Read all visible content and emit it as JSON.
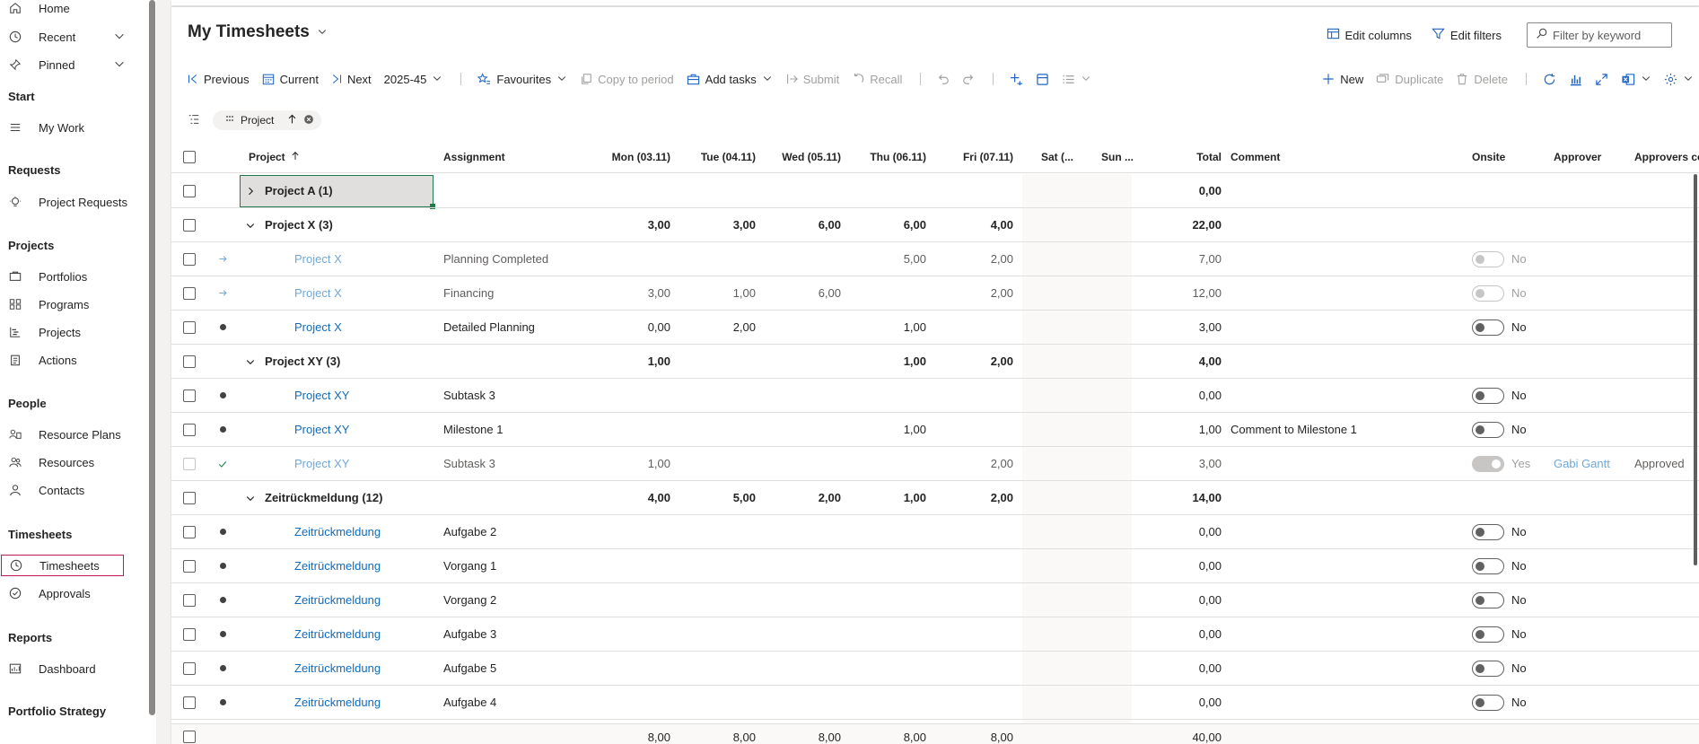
{
  "sidebar": {
    "home": "Home",
    "recent": "Recent",
    "pinned": "Pinned",
    "sections": {
      "start": "Start",
      "requests": "Requests",
      "projects": "Projects",
      "people": "People",
      "timesheets": "Timesheets",
      "reports": "Reports",
      "portfolio_strategy": "Portfolio Strategy"
    },
    "items": {
      "my_work": "My Work",
      "project_requests": "Project Requests",
      "portfolios": "Portfolios",
      "programs": "Programs",
      "projects": "Projects",
      "actions": "Actions",
      "resource_plans": "Resource Plans",
      "resources": "Resources",
      "contacts": "Contacts",
      "timesheets": "Timesheets",
      "approvals": "Approvals",
      "dashboard": "Dashboard"
    }
  },
  "header": {
    "title": "My Timesheets",
    "edit_columns": "Edit columns",
    "edit_filters": "Edit filters",
    "filter_placeholder": "Filter by keyword"
  },
  "toolbar": {
    "previous": "Previous",
    "current": "Current",
    "next": "Next",
    "period": "2025-45",
    "favourites": "Favourites",
    "copy_to_period": "Copy to period",
    "add_tasks": "Add tasks",
    "submit": "Submit",
    "recall": "Recall",
    "new": "New",
    "duplicate": "Duplicate",
    "delete": "Delete"
  },
  "group_chip": {
    "label": "Project"
  },
  "columns": {
    "project": "Project",
    "assignment": "Assignment",
    "mon": "Mon (03.11)",
    "tue": "Tue (04.11)",
    "wed": "Wed (05.11)",
    "thu": "Thu (06.11)",
    "fri": "Fri (07.11)",
    "sat": "Sat (...",
    "sun": "Sun ...",
    "total": "Total",
    "comment": "Comment",
    "onsite": "Onsite",
    "approver": "Approver",
    "approvers_comment": "Approvers com"
  },
  "rows": [
    {
      "group": true,
      "collapsed": true,
      "project": "Project A (1)",
      "total": "0,00"
    },
    {
      "group": true,
      "project": "Project X (3)",
      "mon": "3,00",
      "tue": "3,00",
      "wed": "6,00",
      "thu": "6,00",
      "fri": "4,00",
      "total": "22,00"
    },
    {
      "status": "arrow",
      "dim": true,
      "project": "Project X",
      "assignment": "Planning Completed",
      "thu": "5,00",
      "fri": "2,00",
      "total": "7,00",
      "onsite": "No",
      "toggle": "dis"
    },
    {
      "status": "arrow",
      "dim": true,
      "project": "Project X",
      "assignment": "Financing",
      "mon": "3,00",
      "tue": "1,00",
      "wed": "6,00",
      "fri": "2,00",
      "total": "12,00",
      "onsite": "No",
      "toggle": "dis"
    },
    {
      "status": "dot",
      "project": "Project X",
      "assignment": "Detailed Planning",
      "mon": "0,00",
      "tue": "2,00",
      "thu": "1,00",
      "total": "3,00",
      "onsite": "No",
      "toggle": "off"
    },
    {
      "group": true,
      "project": "Project XY (3)",
      "mon": "1,00",
      "thu": "1,00",
      "fri": "2,00",
      "total": "4,00"
    },
    {
      "status": "dot",
      "project": "Project XY",
      "assignment": "Subtask 3",
      "total": "0,00",
      "onsite": "No",
      "toggle": "off"
    },
    {
      "status": "dot",
      "project": "Project XY",
      "assignment": "Milestone 1",
      "thu": "1,00",
      "total": "1,00",
      "comment": "Comment to Milestone 1",
      "onsite": "No",
      "toggle": "off"
    },
    {
      "status": "check",
      "dim": true,
      "project": "Project XY",
      "assignment": "Subtask 3",
      "mon": "1,00",
      "fri": "2,00",
      "total": "3,00",
      "onsite": "Yes",
      "toggle": "on",
      "approver": "Gabi Gantt",
      "approvers_comment": "Approved"
    },
    {
      "group": true,
      "project": "Zeitrückmeldung (12)",
      "mon": "4,00",
      "tue": "5,00",
      "wed": "2,00",
      "thu": "1,00",
      "fri": "2,00",
      "total": "14,00"
    },
    {
      "status": "dot",
      "project": "Zeitrückmeldung",
      "assignment": "Aufgabe 2",
      "total": "0,00",
      "onsite": "No",
      "toggle": "off"
    },
    {
      "status": "dot",
      "project": "Zeitrückmeldung",
      "assignment": "Vorgang 1",
      "total": "0,00",
      "onsite": "No",
      "toggle": "off"
    },
    {
      "status": "dot",
      "project": "Zeitrückmeldung",
      "assignment": "Vorgang 2",
      "total": "0,00",
      "onsite": "No",
      "toggle": "off"
    },
    {
      "status": "dot",
      "project": "Zeitrückmeldung",
      "assignment": "Aufgabe 3",
      "total": "0,00",
      "onsite": "No",
      "toggle": "off"
    },
    {
      "status": "dot",
      "project": "Zeitrückmeldung",
      "assignment": "Aufgabe 5",
      "total": "0,00",
      "onsite": "No",
      "toggle": "off"
    },
    {
      "status": "dot",
      "project": "Zeitrückmeldung",
      "assignment": "Aufgabe 4",
      "total": "0,00",
      "onsite": "No",
      "toggle": "off"
    }
  ],
  "footer": {
    "mon": "8,00",
    "tue": "8,00",
    "wed": "8,00",
    "thu": "8,00",
    "fri": "8,00",
    "total": "40,00"
  }
}
